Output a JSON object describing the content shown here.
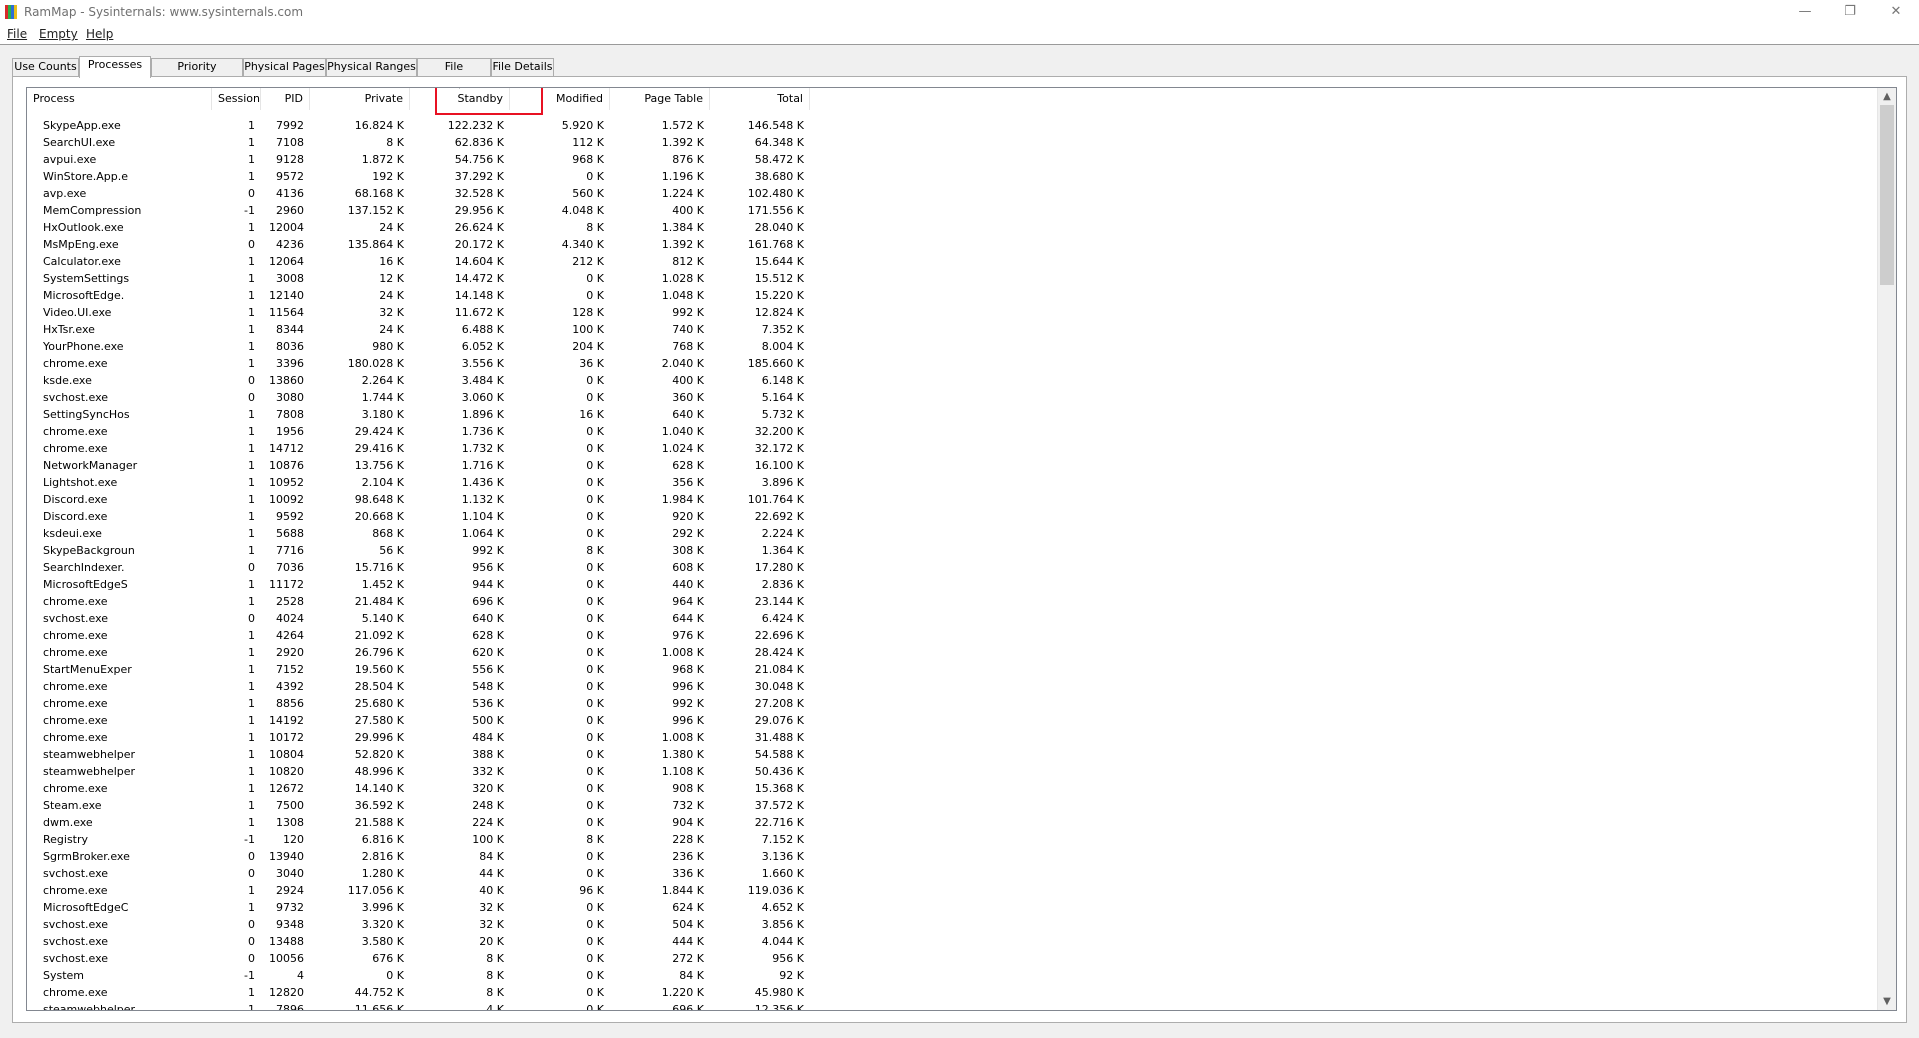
{
  "window": {
    "title": "RamMap - Sysinternals: www.sysinternals.com",
    "minimize": "—",
    "restore": "❐",
    "close": "✕"
  },
  "menu": {
    "items": [
      {
        "label": "File"
      },
      {
        "label": "Empty"
      },
      {
        "label": "Help"
      }
    ]
  },
  "tabs": [
    {
      "label": "Use Counts"
    },
    {
      "label": "Processes"
    },
    {
      "label": "Priority Summary"
    },
    {
      "label": "Physical Pages"
    },
    {
      "label": "Physical Ranges"
    },
    {
      "label": "File Summary"
    },
    {
      "label": "File Details"
    }
  ],
  "active_tab": "Processes",
  "table": {
    "columns": [
      "Process",
      "Session",
      "PID",
      "Private",
      "Standby",
      "Modified",
      "Page Table",
      "Total"
    ],
    "sort_column": "Standby",
    "sort_indicator": "˅",
    "rows": [
      [
        "SkypeApp.exe",
        "1",
        "7992",
        "16.824 K",
        "122.232 K",
        "5.920 K",
        "1.572 K",
        "146.548 K"
      ],
      [
        "SearchUI.exe",
        "1",
        "7108",
        "8 K",
        "62.836 K",
        "112 K",
        "1.392 K",
        "64.348 K"
      ],
      [
        "avpui.exe",
        "1",
        "9128",
        "1.872 K",
        "54.756 K",
        "968 K",
        "876 K",
        "58.472 K"
      ],
      [
        "WinStore.App.e",
        "1",
        "9572",
        "192 K",
        "37.292 K",
        "0 K",
        "1.196 K",
        "38.680 K"
      ],
      [
        "avp.exe",
        "0",
        "4136",
        "68.168 K",
        "32.528 K",
        "560 K",
        "1.224 K",
        "102.480 K"
      ],
      [
        "MemCompression",
        "-1",
        "2960",
        "137.152 K",
        "29.956 K",
        "4.048 K",
        "400 K",
        "171.556 K"
      ],
      [
        "HxOutlook.exe",
        "1",
        "12004",
        "24 K",
        "26.624 K",
        "8 K",
        "1.384 K",
        "28.040 K"
      ],
      [
        "MsMpEng.exe",
        "0",
        "4236",
        "135.864 K",
        "20.172 K",
        "4.340 K",
        "1.392 K",
        "161.768 K"
      ],
      [
        "Calculator.exe",
        "1",
        "12064",
        "16 K",
        "14.604 K",
        "212 K",
        "812 K",
        "15.644 K"
      ],
      [
        "SystemSettings",
        "1",
        "3008",
        "12 K",
        "14.472 K",
        "0 K",
        "1.028 K",
        "15.512 K"
      ],
      [
        "MicrosoftEdge.",
        "1",
        "12140",
        "24 K",
        "14.148 K",
        "0 K",
        "1.048 K",
        "15.220 K"
      ],
      [
        "Video.UI.exe",
        "1",
        "11564",
        "32 K",
        "11.672 K",
        "128 K",
        "992 K",
        "12.824 K"
      ],
      [
        "HxTsr.exe",
        "1",
        "8344",
        "24 K",
        "6.488 K",
        "100 K",
        "740 K",
        "7.352 K"
      ],
      [
        "YourPhone.exe",
        "1",
        "8036",
        "980 K",
        "6.052 K",
        "204 K",
        "768 K",
        "8.004 K"
      ],
      [
        "chrome.exe",
        "1",
        "3396",
        "180.028 K",
        "3.556 K",
        "36 K",
        "2.040 K",
        "185.660 K"
      ],
      [
        "ksde.exe",
        "0",
        "13860",
        "2.264 K",
        "3.484 K",
        "0 K",
        "400 K",
        "6.148 K"
      ],
      [
        "svchost.exe",
        "0",
        "3080",
        "1.744 K",
        "3.060 K",
        "0 K",
        "360 K",
        "5.164 K"
      ],
      [
        "SettingSyncHos",
        "1",
        "7808",
        "3.180 K",
        "1.896 K",
        "16 K",
        "640 K",
        "5.732 K"
      ],
      [
        "chrome.exe",
        "1",
        "1956",
        "29.424 K",
        "1.736 K",
        "0 K",
        "1.040 K",
        "32.200 K"
      ],
      [
        "chrome.exe",
        "1",
        "14712",
        "29.416 K",
        "1.732 K",
        "0 K",
        "1.024 K",
        "32.172 K"
      ],
      [
        "NetworkManager",
        "1",
        "10876",
        "13.756 K",
        "1.716 K",
        "0 K",
        "628 K",
        "16.100 K"
      ],
      [
        "Lightshot.exe",
        "1",
        "10952",
        "2.104 K",
        "1.436 K",
        "0 K",
        "356 K",
        "3.896 K"
      ],
      [
        "Discord.exe",
        "1",
        "10092",
        "98.648 K",
        "1.132 K",
        "0 K",
        "1.984 K",
        "101.764 K"
      ],
      [
        "Discord.exe",
        "1",
        "9592",
        "20.668 K",
        "1.104 K",
        "0 K",
        "920 K",
        "22.692 K"
      ],
      [
        "ksdeui.exe",
        "1",
        "5688",
        "868 K",
        "1.064 K",
        "0 K",
        "292 K",
        "2.224 K"
      ],
      [
        "SkypeBackgroun",
        "1",
        "7716",
        "56 K",
        "992 K",
        "8 K",
        "308 K",
        "1.364 K"
      ],
      [
        "SearchIndexer.",
        "0",
        "7036",
        "15.716 K",
        "956 K",
        "0 K",
        "608 K",
        "17.280 K"
      ],
      [
        "MicrosoftEdgeS",
        "1",
        "11172",
        "1.452 K",
        "944 K",
        "0 K",
        "440 K",
        "2.836 K"
      ],
      [
        "chrome.exe",
        "1",
        "2528",
        "21.484 K",
        "696 K",
        "0 K",
        "964 K",
        "23.144 K"
      ],
      [
        "svchost.exe",
        "0",
        "4024",
        "5.140 K",
        "640 K",
        "0 K",
        "644 K",
        "6.424 K"
      ],
      [
        "chrome.exe",
        "1",
        "4264",
        "21.092 K",
        "628 K",
        "0 K",
        "976 K",
        "22.696 K"
      ],
      [
        "chrome.exe",
        "1",
        "2920",
        "26.796 K",
        "620 K",
        "0 K",
        "1.008 K",
        "28.424 K"
      ],
      [
        "StartMenuExper",
        "1",
        "7152",
        "19.560 K",
        "556 K",
        "0 K",
        "968 K",
        "21.084 K"
      ],
      [
        "chrome.exe",
        "1",
        "4392",
        "28.504 K",
        "548 K",
        "0 K",
        "996 K",
        "30.048 K"
      ],
      [
        "chrome.exe",
        "1",
        "8856",
        "25.680 K",
        "536 K",
        "0 K",
        "992 K",
        "27.208 K"
      ],
      [
        "chrome.exe",
        "1",
        "14192",
        "27.580 K",
        "500 K",
        "0 K",
        "996 K",
        "29.076 K"
      ],
      [
        "chrome.exe",
        "1",
        "10172",
        "29.996 K",
        "484 K",
        "0 K",
        "1.008 K",
        "31.488 K"
      ],
      [
        "steamwebhelper",
        "1",
        "10804",
        "52.820 K",
        "388 K",
        "0 K",
        "1.380 K",
        "54.588 K"
      ],
      [
        "steamwebhelper",
        "1",
        "10820",
        "48.996 K",
        "332 K",
        "0 K",
        "1.108 K",
        "50.436 K"
      ],
      [
        "chrome.exe",
        "1",
        "12672",
        "14.140 K",
        "320 K",
        "0 K",
        "908 K",
        "15.368 K"
      ],
      [
        "Steam.exe",
        "1",
        "7500",
        "36.592 K",
        "248 K",
        "0 K",
        "732 K",
        "37.572 K"
      ],
      [
        "dwm.exe",
        "1",
        "1308",
        "21.588 K",
        "224 K",
        "0 K",
        "904 K",
        "22.716 K"
      ],
      [
        "Registry",
        "-1",
        "120",
        "6.816 K",
        "100 K",
        "8 K",
        "228 K",
        "7.152 K"
      ],
      [
        "SgrmBroker.exe",
        "0",
        "13940",
        "2.816 K",
        "84 K",
        "0 K",
        "236 K",
        "3.136 K"
      ],
      [
        "svchost.exe",
        "0",
        "3040",
        "1.280 K",
        "44 K",
        "0 K",
        "336 K",
        "1.660 K"
      ],
      [
        "chrome.exe",
        "1",
        "2924",
        "117.056 K",
        "40 K",
        "96 K",
        "1.844 K",
        "119.036 K"
      ],
      [
        "MicrosoftEdgeC",
        "1",
        "9732",
        "3.996 K",
        "32 K",
        "0 K",
        "624 K",
        "4.652 K"
      ],
      [
        "svchost.exe",
        "0",
        "9348",
        "3.320 K",
        "32 K",
        "0 K",
        "504 K",
        "3.856 K"
      ],
      [
        "svchost.exe",
        "0",
        "13488",
        "3.580 K",
        "20 K",
        "0 K",
        "444 K",
        "4.044 K"
      ],
      [
        "svchost.exe",
        "0",
        "10056",
        "676 K",
        "8 K",
        "0 K",
        "272 K",
        "956 K"
      ],
      [
        "System",
        "-1",
        "4",
        "0 K",
        "8 K",
        "0 K",
        "84 K",
        "92 K"
      ],
      [
        "chrome.exe",
        "1",
        "12820",
        "44.752 K",
        "8 K",
        "0 K",
        "1.220 K",
        "45.980 K"
      ],
      [
        "steamwebhelper",
        "1",
        "7896",
        "11.656 K",
        "4 K",
        "0 K",
        "696 K",
        "12.356 K"
      ]
    ]
  },
  "scrollbar": {
    "up": "▲",
    "down": "▼"
  },
  "icons": {
    "app": "rammap-icon"
  }
}
